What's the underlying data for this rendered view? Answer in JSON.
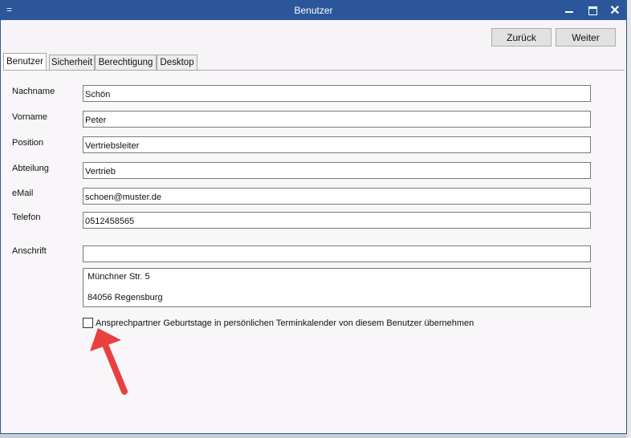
{
  "window": {
    "title": "Benutzer",
    "menu_glyph": "=",
    "close_glyph": "✕"
  },
  "toolbar": {
    "back_label": "Zurück",
    "next_label": "Weiter"
  },
  "tabs": [
    {
      "label": "Benutzer",
      "active": true
    },
    {
      "label": "Sicherheit",
      "active": false
    },
    {
      "label": "Berechtigung",
      "active": false
    },
    {
      "label": "Desktop",
      "active": false
    }
  ],
  "form": {
    "nachname": {
      "label": "Nachname",
      "value": "Schön"
    },
    "vorname": {
      "label": "Vorname",
      "value": "Peter"
    },
    "position": {
      "label": "Position",
      "value": "Vertriebsleiter"
    },
    "abteilung": {
      "label": "Abteilung",
      "value": "Vertrieb"
    },
    "email": {
      "label": "eMail",
      "value": "schoen@muster.de"
    },
    "telefon": {
      "label": "Telefon",
      "value": "0512458565"
    },
    "anschrift": {
      "label": "Anschrift",
      "line1_value": "",
      "address_lines": [
        "Münchner Str. 5",
        "84056 Regensburg"
      ]
    },
    "checkbox": {
      "label": "Ansprechpartner Geburtstage in persönlichen Terminkalender von diesem Benutzer übernehmen",
      "checked": false
    }
  },
  "colors": {
    "titlebar": "#2b579a",
    "arrow": "#e8403f"
  }
}
